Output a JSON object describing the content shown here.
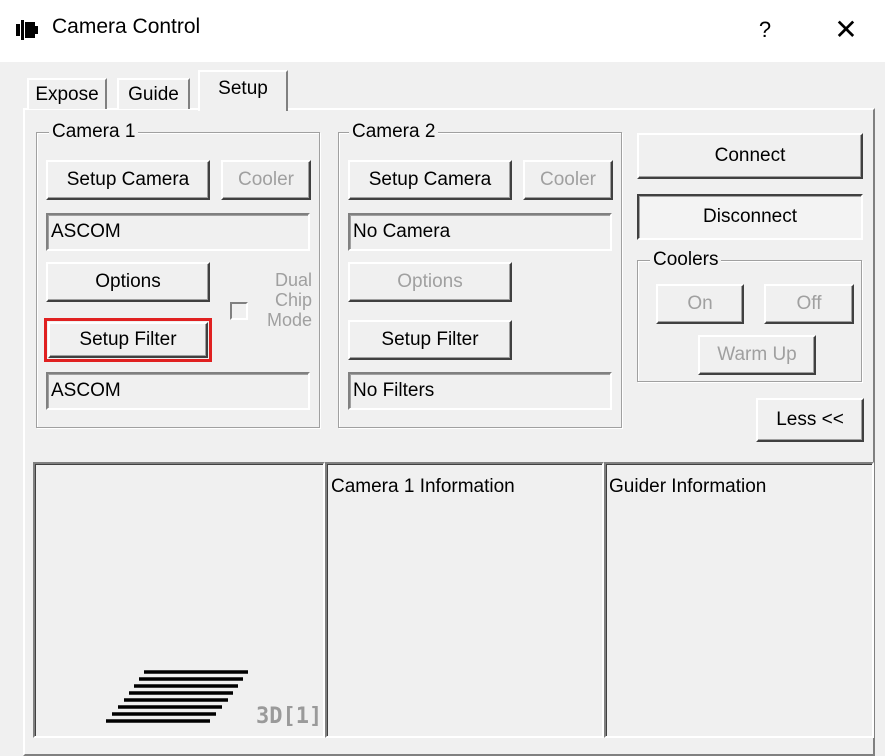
{
  "window": {
    "title": "Camera Control",
    "help_glyph": "?",
    "close_glyph": "✕"
  },
  "tabs": [
    {
      "label": "Expose",
      "active": false
    },
    {
      "label": "Guide",
      "active": false
    },
    {
      "label": "Setup",
      "active": true
    }
  ],
  "camera1": {
    "title": "Camera 1",
    "setup_camera": "Setup Camera",
    "cooler": "Cooler",
    "camera_value": "ASCOM",
    "options": "Options",
    "dual_chip_mode": [
      "Dual",
      "Chip",
      "Mode"
    ],
    "dual_chip_checked": false,
    "setup_filter": "Setup Filter",
    "filter_value": "ASCOM"
  },
  "camera2": {
    "title": "Camera 2",
    "setup_camera": "Setup Camera",
    "cooler": "Cooler",
    "camera_value": "No Camera",
    "options": "Options",
    "setup_filter": "Setup Filter",
    "filter_value": "No Filters"
  },
  "connection": {
    "connect": "Connect",
    "disconnect": "Disconnect"
  },
  "coolers": {
    "title": "Coolers",
    "on": "On",
    "off": "Off",
    "warm_up": "Warm Up"
  },
  "less_button": "Less <<",
  "info": {
    "preview_badge": "3D[1]",
    "camera1_info": "Camera 1 Information",
    "guider_info": "Guider Information"
  },
  "colors": {
    "highlight": "#e02020",
    "disabled_text": "#a0a0a0"
  }
}
